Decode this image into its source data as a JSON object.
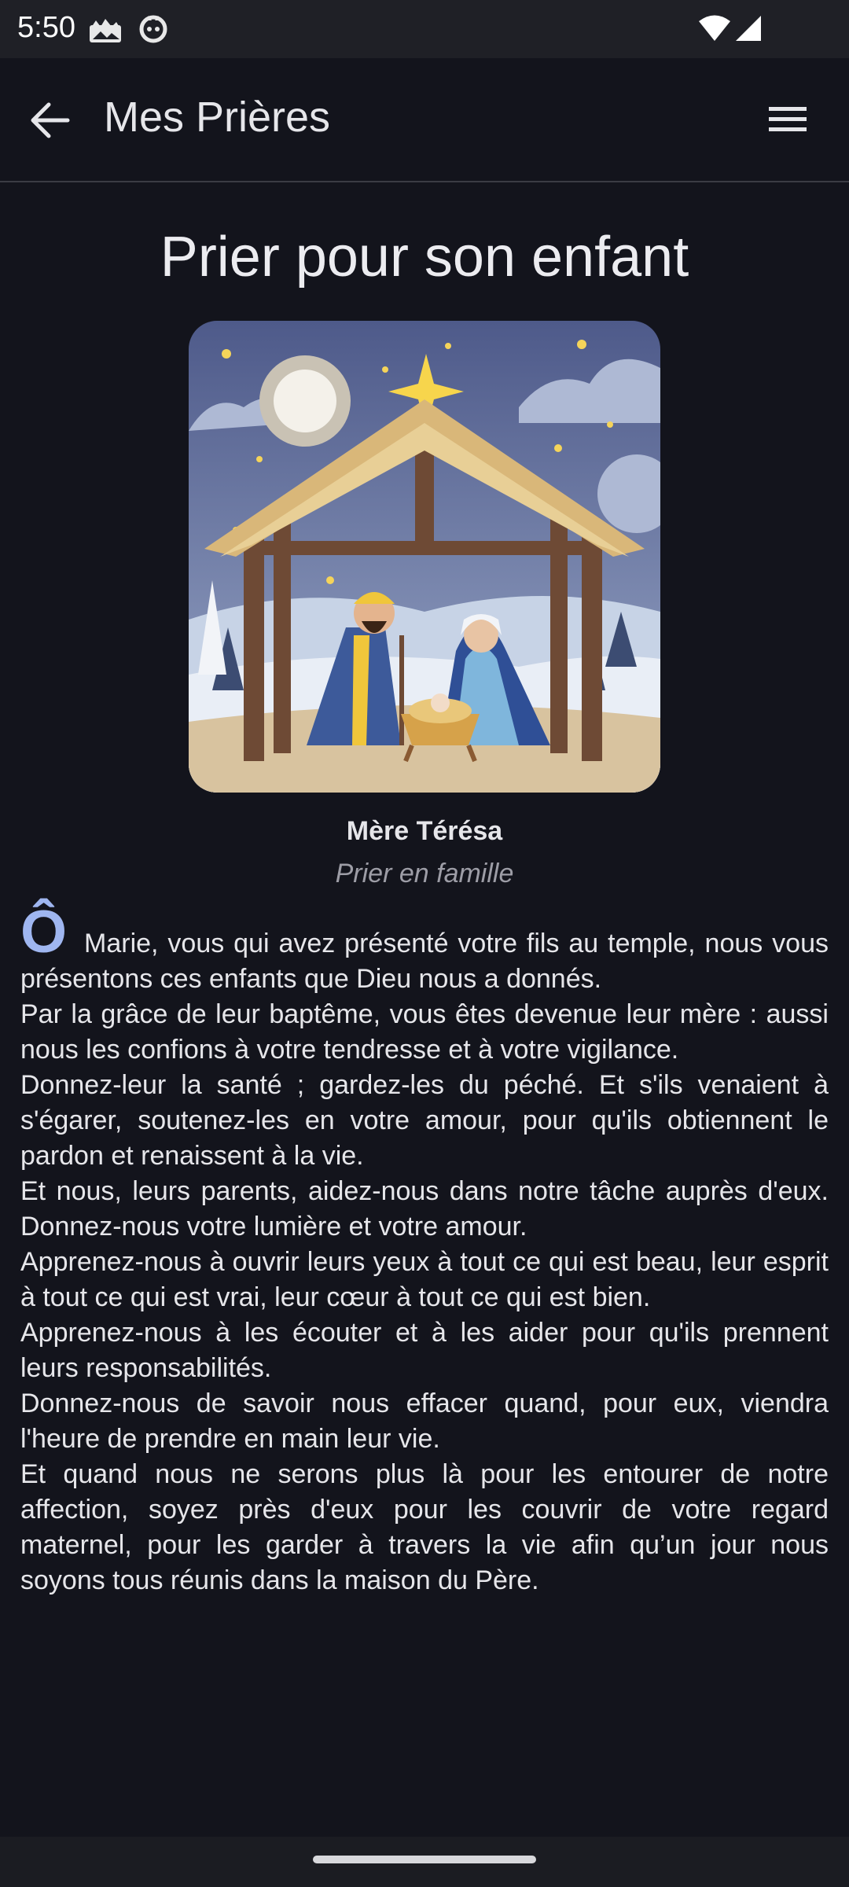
{
  "status_bar": {
    "time": "5:50",
    "left_icons": [
      "photo-notification-icon",
      "app-notification-icon"
    ],
    "right_icons": [
      "wifi-icon",
      "cell-signal-icon"
    ]
  },
  "app_bar": {
    "back_icon": "arrow-back-icon",
    "title": "Mes Prières",
    "menu_icon": "hamburger-menu-icon"
  },
  "prayer": {
    "title": "Prier pour son enfant",
    "image_subject": "nativity-scene-illustration",
    "author": "Mère Térésa",
    "category": "Prier en famille",
    "dropcap": "Ô",
    "first_paragraph_rest": " Marie, vous qui avez présenté votre fils au temple, nous vous présentons ces enfants que Dieu nous a donnés.",
    "paragraphs": [
      "Par la grâce de leur baptême, vous êtes devenue leur mère : aussi nous les confions à votre tendresse et à votre vigilance.",
      "Donnez-leur la santé ; gardez-les du péché. Et s'ils venaient à s'égarer, soutenez-les en votre amour, pour qu'ils obtiennent le pardon et renaissent à la vie.",
      "Et nous, leurs parents, aidez-nous dans notre tâche auprès d'eux. Donnez-nous votre lumière et votre amour.",
      "Apprenez-nous à ouvrir leurs yeux à tout ce qui est beau, leur esprit à tout ce qui est vrai, leur cœur à tout ce qui est bien.",
      "Apprenez-nous à les écouter et à les aider pour qu'ils prennent leurs responsabilités.",
      "Donnez-nous de savoir nous effacer quand, pour eux, viendra l'heure de prendre en main leur vie.",
      "Et quand nous ne serons plus là pour les entourer de notre affection, soyez près d'eux pour les couvrir de votre regard maternel, pour les garder à travers la vie afin qu’un jour nous soyons tous réunis dans la maison du Père."
    ]
  },
  "colors": {
    "background": "#13141c",
    "app_bar_divider": "#3b3c44",
    "dropcap": "#9fb6f0",
    "category_text": "#9d9da6"
  }
}
